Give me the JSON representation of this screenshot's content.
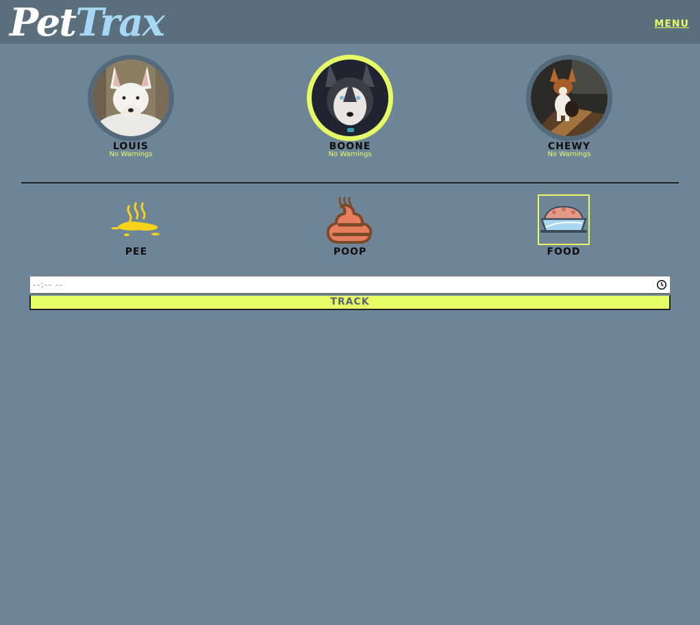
{
  "header": {
    "logo_part1": "Pet",
    "logo_part2": "Trax",
    "menu_label": "MENU"
  },
  "pets": [
    {
      "name": "LOUIS",
      "status": "No Warnings",
      "selected": false
    },
    {
      "name": "BOONE",
      "status": "No Warnings",
      "selected": true
    },
    {
      "name": "CHEWY",
      "status": "No Warnings",
      "selected": false
    }
  ],
  "activities": [
    {
      "label": "PEE",
      "icon": "pee-icon",
      "selected": false
    },
    {
      "label": "POOP",
      "icon": "poop-icon",
      "selected": false
    },
    {
      "label": "FOOD",
      "icon": "food-bowl-icon",
      "selected": true
    }
  ],
  "time_input": {
    "value": "--:-- --"
  },
  "track_button": {
    "label": "TRACK"
  },
  "colors": {
    "background": "#6e8597",
    "header": "#5a6e7c",
    "accent": "#e6fd66",
    "logo_trax": "#a6d8f5"
  }
}
